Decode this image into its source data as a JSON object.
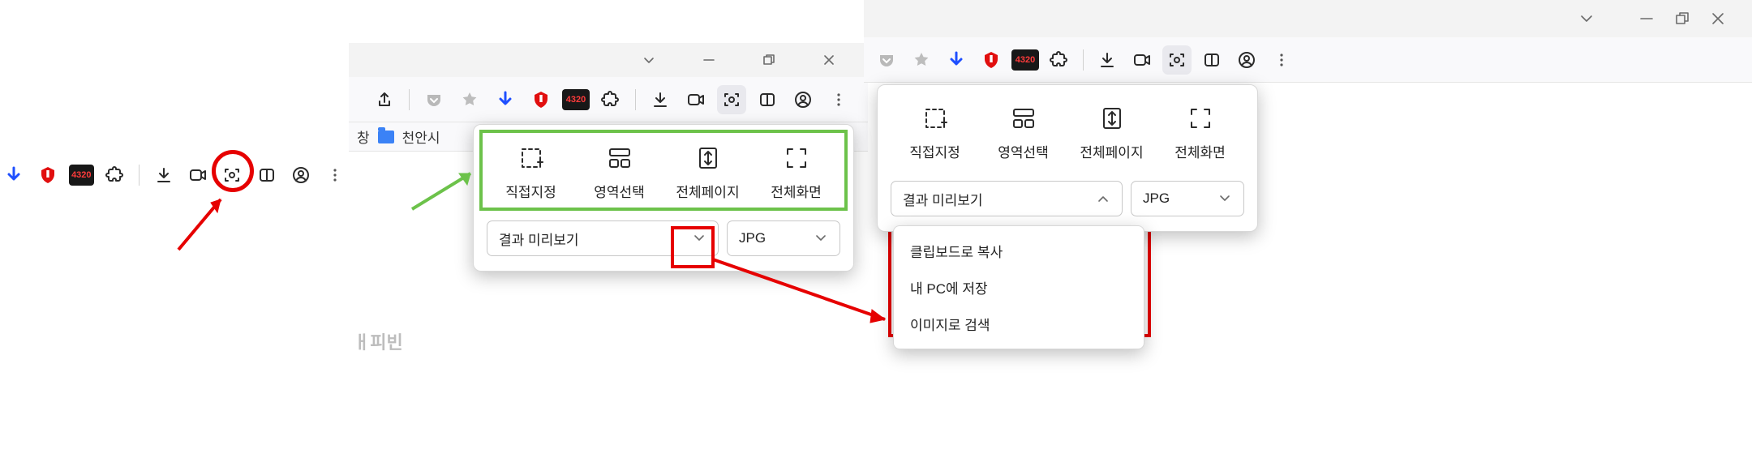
{
  "bookmarks": {
    "label_a": "창",
    "label_b": "천안시",
    "cut_text": "ㅐ피빈"
  },
  "capture_popup": {
    "items": [
      {
        "label": "직접지정"
      },
      {
        "label": "영역선택"
      },
      {
        "label": "전체페이지"
      },
      {
        "label": "전체화면"
      }
    ],
    "preview_label": "결과 미리보기",
    "format": "JPG"
  },
  "preview_menu": {
    "items": [
      {
        "label": "클립보드로 복사"
      },
      {
        "label": "내 PC에 저장"
      },
      {
        "label": "이미지로 검색"
      }
    ]
  },
  "badge": "4320"
}
